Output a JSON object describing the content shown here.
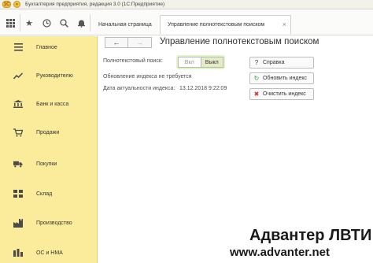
{
  "window": {
    "logo_text": "1С",
    "title": "Бухгалтерия предприятия, редакция 3.0  (1С:Предприятие)"
  },
  "toolbar": {
    "apps_icon": "grid-icon",
    "favorites_icon": "star-icon",
    "history_icon": "clock-icon",
    "tabs": [
      {
        "label": "Начальная страница"
      },
      {
        "label": "Управление полнотекстовым поиском",
        "close": "×"
      }
    ]
  },
  "sidebar": {
    "items": [
      {
        "icon": "menu-lines-icon",
        "label": "Главное"
      },
      {
        "icon": "trend-line-icon",
        "label": "Руководителю"
      },
      {
        "icon": "bank-icon",
        "label": "Банк и касса"
      },
      {
        "icon": "cart-icon",
        "label": "Продажи"
      },
      {
        "icon": "truck-icon",
        "label": "Покупки"
      },
      {
        "icon": "warehouse-icon",
        "label": "Склад"
      },
      {
        "icon": "factory-icon",
        "label": "Производство"
      },
      {
        "icon": "assets-icon",
        "label": "ОС и НМА"
      }
    ]
  },
  "main": {
    "nav": {
      "back": "←",
      "forward": "→"
    },
    "title": "Управление полнотекстовым поиском",
    "search_label": "Полнотекстовый поиск:",
    "toggle": {
      "on": "Вкл",
      "off": "Выкл",
      "selected": "Выкл"
    },
    "index_status": "Обновление индекса не требуется",
    "index_date_label": "Дата актуальности индекса:",
    "index_date": "13.12.2018  9:22:09",
    "buttons": [
      {
        "icon": "?",
        "label": "Справка",
        "color": "#333333"
      },
      {
        "icon": "↻",
        "label": "Обновить индекс",
        "color": "#3a9a3a"
      },
      {
        "icon": "✖",
        "label": "Очистить индекс",
        "color": "#d23a3a"
      }
    ]
  },
  "watermark": {
    "title": "Адвантер ЛВТИ",
    "url": "www.advanter.net"
  },
  "colors": {
    "sidebar_bg": "#fbec9c",
    "toggle_highlight": "#dff5c4",
    "toggle_selected": "#e4ecc7"
  }
}
